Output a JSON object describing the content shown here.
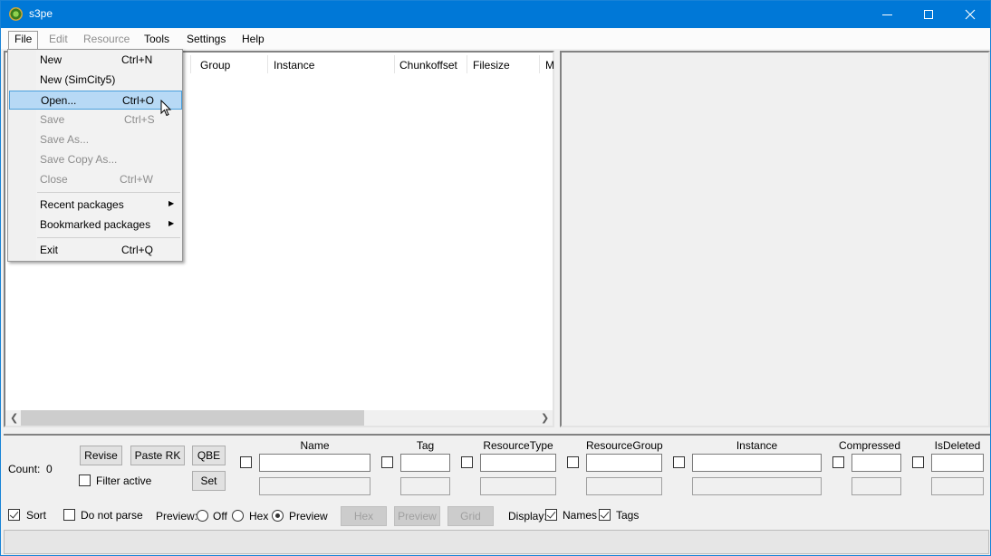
{
  "window": {
    "title": "s3pe",
    "app_icon": "s3pe-app-icon",
    "controls": [
      "minimize",
      "maximize",
      "close"
    ]
  },
  "menubar": {
    "items": [
      {
        "label": "File",
        "enabled": true,
        "open": true
      },
      {
        "label": "Edit",
        "enabled": false
      },
      {
        "label": "Resource",
        "enabled": false
      },
      {
        "label": "Tools",
        "enabled": true
      },
      {
        "label": "Settings",
        "enabled": true
      },
      {
        "label": "Help",
        "enabled": true
      }
    ]
  },
  "file_menu": {
    "items": [
      {
        "label": "New",
        "shortcut": "Ctrl+N",
        "enabled": true
      },
      {
        "label": "New (SimCity5)",
        "shortcut": "",
        "enabled": true
      },
      {
        "label": "Open...",
        "shortcut": "Ctrl+O",
        "enabled": true,
        "highlighted": true
      },
      {
        "label": "Save",
        "shortcut": "Ctrl+S",
        "enabled": false
      },
      {
        "label": "Save As...",
        "shortcut": "",
        "enabled": false
      },
      {
        "label": "Save Copy As...",
        "shortcut": "",
        "enabled": false
      },
      {
        "label": "Close",
        "shortcut": "Ctrl+W",
        "enabled": false
      },
      {
        "label": "Recent packages",
        "submenu": true,
        "enabled": true
      },
      {
        "label": "Bookmarked packages",
        "submenu": true,
        "enabled": true
      },
      {
        "label": "Exit",
        "shortcut": "Ctrl+Q",
        "enabled": true
      }
    ]
  },
  "resource_list": {
    "columns": [
      "Group",
      "Instance",
      "Chunkoffset",
      "Filesize",
      "M"
    ],
    "rows": []
  },
  "filter": {
    "count_label": "Count:",
    "count_value": "0",
    "buttons": {
      "revise": "Revise",
      "paste_rk": "Paste RK",
      "qbe": "QBE",
      "set": "Set"
    },
    "filter_active_label": "Filter active",
    "filter_active_checked": false,
    "fields": [
      {
        "label": "Name",
        "value": "",
        "checked": false
      },
      {
        "label": "Tag",
        "value": "",
        "checked": false
      },
      {
        "label": "ResourceType",
        "value": "",
        "checked": false
      },
      {
        "label": "ResourceGroup",
        "value": "",
        "checked": false
      },
      {
        "label": "Instance",
        "value": "",
        "checked": false
      },
      {
        "label": "Compressed",
        "value": "",
        "checked": false
      },
      {
        "label": "IsDeleted",
        "value": "",
        "checked": false
      }
    ]
  },
  "options": {
    "sort_label": "Sort",
    "sort_checked": true,
    "do_not_parse_label": "Do not parse",
    "do_not_parse_checked": false,
    "preview_label": "Preview:",
    "preview_options": [
      "Off",
      "Hex",
      "Preview"
    ],
    "preview_selected": "Preview",
    "view_buttons": [
      "Hex",
      "Preview",
      "Grid"
    ],
    "display_label": "Display:",
    "display_names_label": "Names",
    "display_names_checked": true,
    "display_tags_label": "Tags",
    "display_tags_checked": true
  },
  "status": {
    "text": ""
  }
}
